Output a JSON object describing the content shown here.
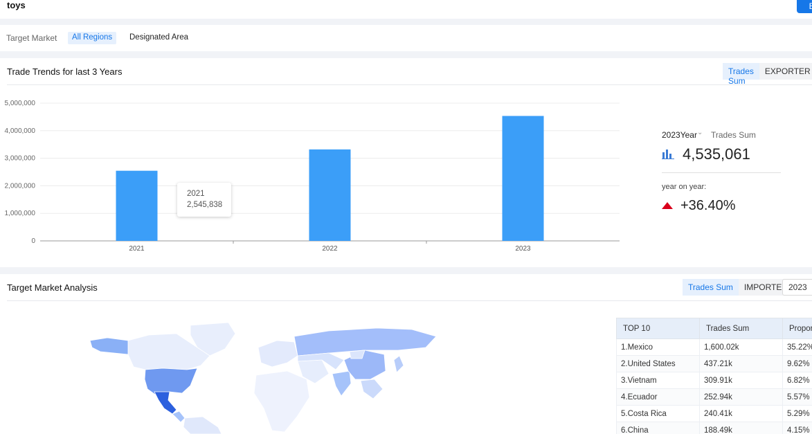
{
  "search": {
    "query": "toys",
    "edit_label": "Ed"
  },
  "filter": {
    "label": "Target Market",
    "active_option": "All Regions",
    "option2": "Designated Area"
  },
  "trends": {
    "title": "Trade Trends for last 3 Years",
    "toggle_a": "Trades Sum",
    "toggle_b": "EXPORTER",
    "tooltip": {
      "year": "2021",
      "value": "2,545,838"
    },
    "stats": {
      "year_select": "2023Year",
      "metric": "Trades Sum",
      "total": "4,535,061",
      "yoy_label": "year on year:",
      "yoy_value": "+36.40%"
    }
  },
  "chart_data": {
    "type": "bar",
    "categories": [
      "2021",
      "2022",
      "2023"
    ],
    "values": [
      2545838,
      3320000,
      4535061
    ],
    "ylim": [
      0,
      5000000
    ],
    "yticks": [
      0,
      1000000,
      2000000,
      3000000,
      4000000,
      5000000
    ],
    "ytick_labels": [
      "0",
      "1,000,000",
      "2,000,000",
      "3,000,000",
      "4,000,000",
      "5,000,000"
    ],
    "grid": true,
    "bar_color": "#3b9ef8"
  },
  "market": {
    "title": "Target Market Analysis",
    "toggle_a": "Trades Sum",
    "toggle_b": "IMPORTER",
    "year": "2023",
    "table": {
      "headers": [
        "TOP 10",
        "Trades Sum",
        "Proport"
      ],
      "rows": [
        [
          "1.Mexico",
          "1,600.02k",
          "35.22%"
        ],
        [
          "2.United States",
          "437.21k",
          "9.62%"
        ],
        [
          "3.Vietnam",
          "309.91k",
          "6.82%"
        ],
        [
          "4.Ecuador",
          "252.94k",
          "5.57%"
        ],
        [
          "5.Costa Rica",
          "240.41k",
          "5.29%"
        ],
        [
          "6.China",
          "188.49k",
          "4.15%"
        ]
      ]
    }
  },
  "colors": {
    "accent": "#1677e8",
    "bar": "#3b9ef8",
    "up": "#d9001b"
  }
}
